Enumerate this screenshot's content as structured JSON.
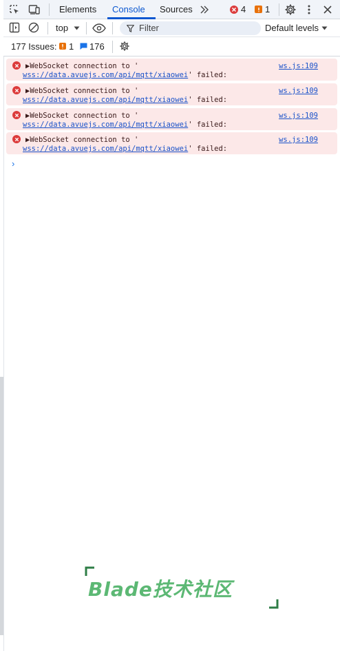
{
  "tabs": [
    {
      "label": "Elements"
    },
    {
      "label": "Console"
    },
    {
      "label": "Sources"
    }
  ],
  "toolbar": {
    "error_count": "4",
    "warning_count": "1"
  },
  "console_toolbar": {
    "context": "top",
    "filter_placeholder": "Filter",
    "levels": "Default levels"
  },
  "issues": {
    "label": "177 Issues:",
    "warning_count": "1",
    "info_count": "176"
  },
  "messages": [
    {
      "text": "WebSocket connection to '",
      "url": "wss://data.avuejs.com/api/mqtt/xiaowei",
      "suffix": "' failed:",
      "source": "ws.js:109"
    },
    {
      "text": "WebSocket connection to '",
      "url": "wss://data.avuejs.com/api/mqtt/xiaowei",
      "suffix": "' failed:",
      "source": "ws.js:109"
    },
    {
      "text": "WebSocket connection to '",
      "url": "wss://data.avuejs.com/api/mqtt/xiaowei",
      "suffix": "' failed:",
      "source": "ws.js:109"
    },
    {
      "text": "WebSocket connection to '",
      "url": "wss://data.avuejs.com/api/mqtt/xiaowei",
      "suffix": "' failed:",
      "source": "ws.js:109"
    }
  ],
  "watermark": "Blade技术社区",
  "colors": {
    "accent": "#0b57d0",
    "error": "#dc3c3c",
    "warning": "#e8710a",
    "info": "#1a73e8",
    "error_bg": "#fce8e8",
    "watermark": "#5cb874"
  }
}
